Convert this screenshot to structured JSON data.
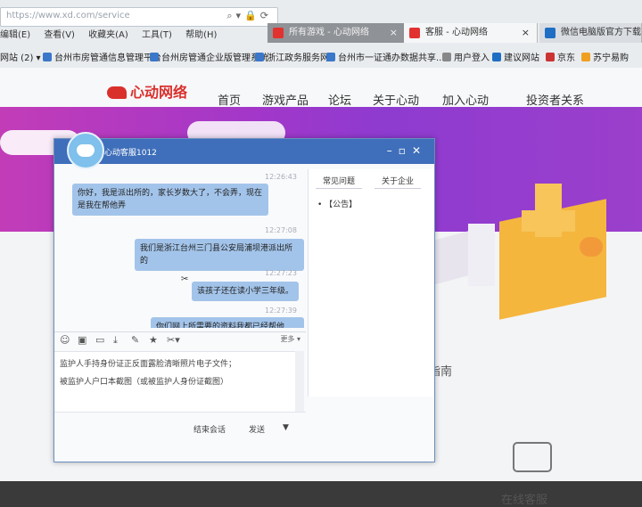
{
  "browser": {
    "url": "https://www.xd.com/service",
    "menu": [
      "编辑(E)",
      "查看(V)",
      "收藏夹(A)",
      "工具(T)",
      "帮助(H)"
    ],
    "tabs": [
      {
        "label": "所有游戏 - 心动网络",
        "close": "×"
      },
      {
        "label": "客服 - 心动网络",
        "close": "×"
      },
      {
        "label": "微信电脑版官方下载 -"
      }
    ],
    "bookmarks": [
      "网站 (2) ▾",
      "台州市房管通信息管理平台",
      "台州房管通企业版管理系统",
      "浙江政务服务网",
      "台州市一证通办数据共享...",
      "用户登入",
      "建议网站",
      "京东",
      "苏宁易购"
    ]
  },
  "site": {
    "logo": "心动网络",
    "nav": [
      "首页",
      "游戏产品",
      "论坛",
      "关于心动",
      "加入心动",
      "投资者关系"
    ],
    "guide": "务指南",
    "online_service": "在线客服"
  },
  "chat": {
    "agent_name": "心动客服1012",
    "messages": [
      {
        "time": "12:26:43",
        "text": "你好，我是派出所的，家长岁数大了，不会弄，现在是我在帮他弄"
      },
      {
        "time": "12:27:08",
        "text": "我们是浙江台州三门县公安局浦坝港派出所的"
      },
      {
        "time": "12:27:23",
        "text": "该孩子还在读小学三年级。"
      },
      {
        "time": "12:27:39",
        "text": "你们网上所需要的资料我都已经帮他备？"
      }
    ],
    "side_tabs": [
      "常见问题",
      "关于企业"
    ],
    "side_items": [
      "【公告】"
    ],
    "toolbar_more": "更多 ▾",
    "input_lines": [
      "监护人手持身份证正反面露脸清晰照片电子文件；",
      "被监护人户口本截图（或被监护人身份证截图）"
    ],
    "end_chat": "结束会话",
    "send": "发送",
    "send_dropdown": "▼"
  },
  "icons": {
    "toolbar": [
      "emoji-icon",
      "image-icon",
      "folder-icon",
      "download-icon",
      "edit-icon",
      "star-icon",
      "scissors-icon"
    ]
  }
}
